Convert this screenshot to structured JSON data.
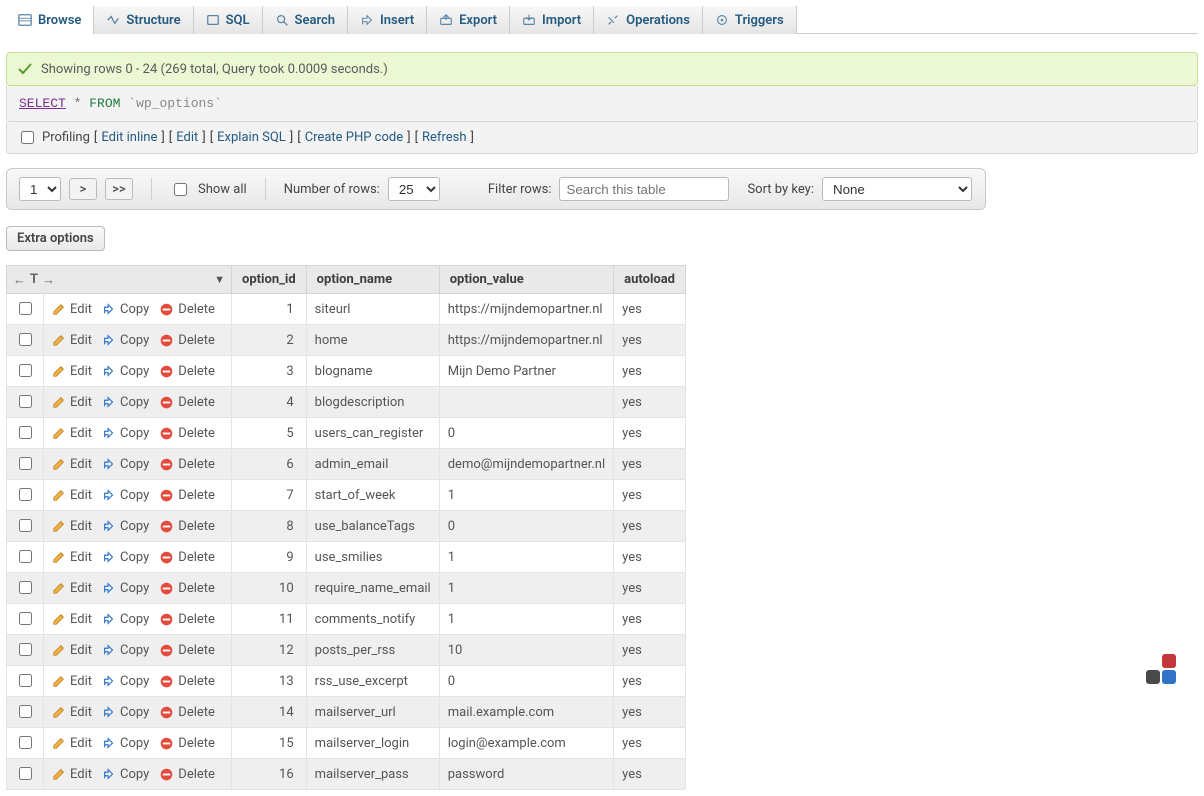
{
  "tabs": {
    "browse": "Browse",
    "structure": "Structure",
    "sql": "SQL",
    "search": "Search",
    "insert": "Insert",
    "export": "Export",
    "import": "Import",
    "operations": "Operations",
    "triggers": "Triggers"
  },
  "success_message": "Showing rows 0 - 24 (269 total, Query took 0.0009 seconds.)",
  "sql": {
    "select": "SELECT",
    "star": "*",
    "from": "FROM",
    "table": "`wp_options`"
  },
  "action_links": {
    "profiling": "Profiling",
    "edit_inline": "Edit inline",
    "edit": "Edit",
    "explain_sql": "Explain SQL",
    "create_php": "Create PHP code",
    "refresh": "Refresh"
  },
  "controls": {
    "page_value": "1",
    "next": ">",
    "last": ">>",
    "show_all": "Show all",
    "num_rows_label": "Number of rows:",
    "num_rows_value": "25",
    "filter_label": "Filter rows:",
    "filter_placeholder": "Search this table",
    "sort_label": "Sort by key:",
    "sort_value": "None"
  },
  "extra_options_label": "Extra options",
  "columns": {
    "option_id": "option_id",
    "option_name": "option_name",
    "option_value": "option_value",
    "autoload": "autoload"
  },
  "fullrow_icons": {
    "left": "←",
    "t": "T",
    "right": "→",
    "tri": "▼"
  },
  "row_labels": {
    "edit": "Edit",
    "copy": "Copy",
    "delete": "Delete"
  },
  "rows": [
    {
      "id": "1",
      "name": "siteurl",
      "value": "https://mijndemopartner.nl",
      "autoload": "yes"
    },
    {
      "id": "2",
      "name": "home",
      "value": "https://mijndemopartner.nl",
      "autoload": "yes"
    },
    {
      "id": "3",
      "name": "blogname",
      "value": "Mijn Demo Partner",
      "autoload": "yes"
    },
    {
      "id": "4",
      "name": "blogdescription",
      "value": "",
      "autoload": "yes"
    },
    {
      "id": "5",
      "name": "users_can_register",
      "value": "0",
      "autoload": "yes"
    },
    {
      "id": "6",
      "name": "admin_email",
      "value": "demo@mijndemopartner.nl",
      "autoload": "yes"
    },
    {
      "id": "7",
      "name": "start_of_week",
      "value": "1",
      "autoload": "yes"
    },
    {
      "id": "8",
      "name": "use_balanceTags",
      "value": "0",
      "autoload": "yes"
    },
    {
      "id": "9",
      "name": "use_smilies",
      "value": "1",
      "autoload": "yes"
    },
    {
      "id": "10",
      "name": "require_name_email",
      "value": "1",
      "autoload": "yes"
    },
    {
      "id": "11",
      "name": "comments_notify",
      "value": "1",
      "autoload": "yes"
    },
    {
      "id": "12",
      "name": "posts_per_rss",
      "value": "10",
      "autoload": "yes"
    },
    {
      "id": "13",
      "name": "rss_use_excerpt",
      "value": "0",
      "autoload": "yes"
    },
    {
      "id": "14",
      "name": "mailserver_url",
      "value": "mail.example.com",
      "autoload": "yes"
    },
    {
      "id": "15",
      "name": "mailserver_login",
      "value": "login@example.com",
      "autoload": "yes"
    },
    {
      "id": "16",
      "name": "mailserver_pass",
      "value": "password",
      "autoload": "yes"
    }
  ],
  "logo_colors": {
    "tr": "#c23737",
    "bl": "#4a4a4a",
    "br": "#2f74c9"
  }
}
